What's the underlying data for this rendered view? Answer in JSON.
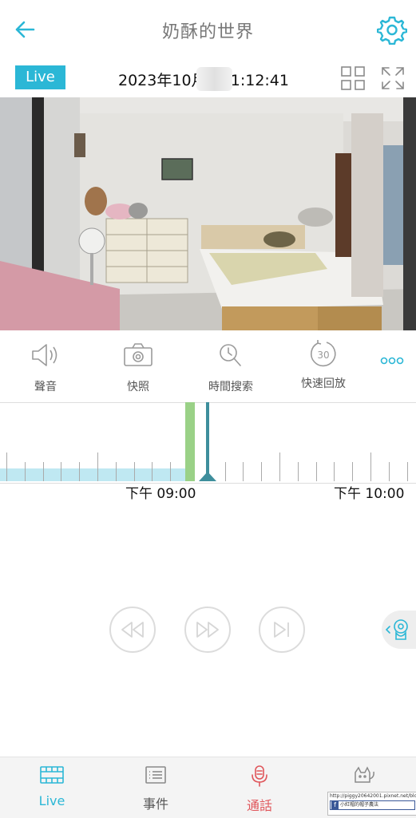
{
  "header": {
    "title": "奶酥的世界",
    "back_icon": "arrow-left-icon",
    "settings_icon": "gear-icon"
  },
  "live_row": {
    "badge": "Live",
    "datetime": "2023年10月    , 21:12:41",
    "icons": [
      "grid-view-icon",
      "fullscreen-icon"
    ]
  },
  "controls": [
    {
      "label": "聲音",
      "icon": "speaker-icon"
    },
    {
      "label": "快照",
      "icon": "camera-icon"
    },
    {
      "label": "時間搜索",
      "icon": "search-time-icon"
    },
    {
      "label": "快速回放",
      "icon": "replay-30-icon"
    }
  ],
  "replay_number": "30",
  "timeline": {
    "labels": [
      "下午 09:00",
      "下午 10:00"
    ]
  },
  "playback": [
    "rewind-icon",
    "fast-forward-icon",
    "skip-next-icon"
  ],
  "bottom_nav": [
    {
      "label": "Live",
      "icon": "film-icon",
      "color": "#2bb7d6"
    },
    {
      "label": "事件",
      "icon": "list-icon",
      "color": "#555555"
    },
    {
      "label": "通話",
      "icon": "microphone-icon",
      "color": "#e0565b"
    },
    {
      "label": "",
      "icon": "pets-icon",
      "color": "#555555"
    }
  ],
  "watermark": {
    "url": "http://piggy20642001.pixnet.net/blog",
    "name": "小紅帽的帽子農法"
  },
  "colors": {
    "accent": "#2bb7d6",
    "cursor": "#3e8e9c",
    "record": "#bfe8f2",
    "event": "#9ad187"
  }
}
